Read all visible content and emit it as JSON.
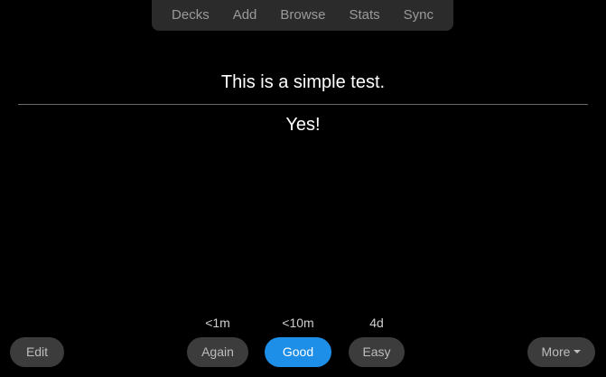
{
  "toolbar": {
    "items": [
      "Decks",
      "Add",
      "Browse",
      "Stats",
      "Sync"
    ]
  },
  "card": {
    "question": "This is a simple test.",
    "answer": "Yes!"
  },
  "review": {
    "edit_label": "Edit",
    "more_label": "More",
    "buttons": [
      {
        "label": "Again",
        "interval": "<1m"
      },
      {
        "label": "Good",
        "interval": "<10m"
      },
      {
        "label": "Easy",
        "interval": "4d"
      }
    ]
  },
  "colors": {
    "background": "#000000",
    "primary_button": "#1e8fe8",
    "secondary_button": "#3c3c3c"
  }
}
